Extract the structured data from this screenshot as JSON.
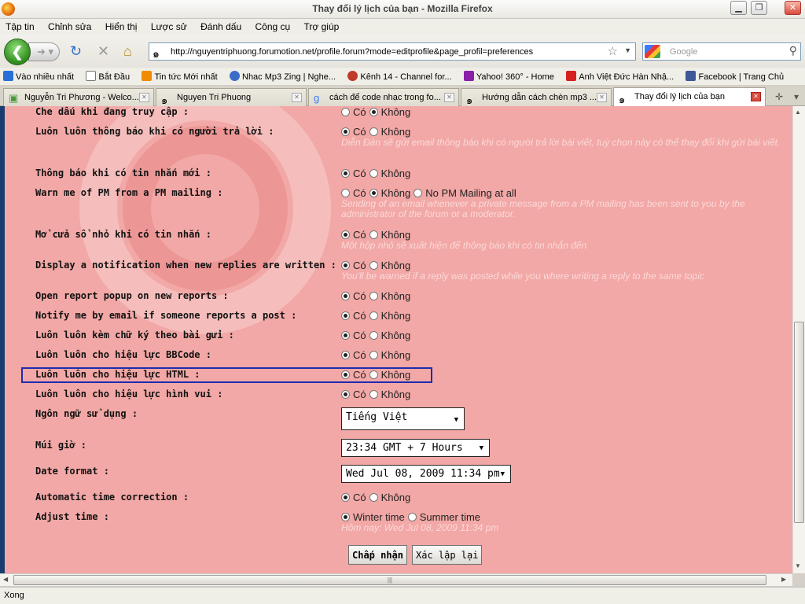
{
  "window": {
    "title": "Thay đổi lý lịch của bạn - Mozilla Firefox"
  },
  "menu": [
    "Tập tin",
    "Chỉnh sửa",
    "Hiển thị",
    "Lược sử",
    "Đánh dấu",
    "Công cụ",
    "Trợ giúp"
  ],
  "urlbar": {
    "url": "http://nguyentriphuong.forumotion.net/profile.forum?mode=editprofile&page_profil=preferences"
  },
  "search": {
    "placeholder": "Google"
  },
  "bookmarks": [
    {
      "label": "Vào nhiều nhất",
      "color": "#2a6fd6"
    },
    {
      "label": "Bắt Đầu",
      "color": "#ffffff"
    },
    {
      "label": "Tin tức Mới nhất",
      "color": "#f08a00"
    },
    {
      "label": "Nhac Mp3 Zing | Nghe...",
      "color": "#3b6cc7"
    },
    {
      "label": "Kênh 14 - Channel for...",
      "color": "#c0392b"
    },
    {
      "label": "Yahoo! 360° - Home",
      "color": "#8b1fa8"
    },
    {
      "label": "Anh Việt Đức Hàn Nhậ...",
      "color": "#d62020"
    },
    {
      "label": "Facebook | Trang Chủ",
      "color": "#3b5998"
    }
  ],
  "tabs": [
    {
      "label": "Nguyễn Tri Phương - Welco...",
      "icon": "chat-icon"
    },
    {
      "label": "Nguyen Tri Phuong",
      "icon": "forumotion-icon"
    },
    {
      "label": "cách để code nhạc trong fo...",
      "icon": "google-icon"
    },
    {
      "label": "Hướng dẫn cách chèn mp3 ...",
      "icon": "forumotion-icon"
    },
    {
      "label": "Thay đổi lý lịch của bạn",
      "icon": "forumotion-icon"
    }
  ],
  "form": {
    "rows": [
      {
        "label": "Che dấu khi đang truy cập :",
        "options": [
          "Có",
          "Không"
        ],
        "selected": 1
      },
      {
        "label": "Luôn luôn thông báo khi có người trả lời :",
        "options": [
          "Có",
          "Không"
        ],
        "selected": 0,
        "desc": "Diễn Đàn sẽ gửi email thông báo khi có người trả lời bài viết, tuỳ chọn này có thể thay đổi khi gửi bài viết."
      },
      {
        "label": "Thông báo khi có tin nhắn mới :",
        "options": [
          "Có",
          "Không"
        ],
        "selected": 0
      },
      {
        "label": "Warn me of PM from a PM mailing :",
        "options": [
          "Có",
          "Không",
          "No PM Mailing at all"
        ],
        "selected": 1,
        "desc": "Sending of an email whenever a private message from a PM mailing has been sent to you by the administrator of the forum or a moderator."
      },
      {
        "label": "Mở cửa sổ nhỏ khi có tin nhắn :",
        "options": [
          "Có",
          "Không"
        ],
        "selected": 0,
        "desc": "Một hộp nhỏ sẽ xuất hiện để thông báo khi có tin nhắn đến"
      },
      {
        "label": "Display a notification when new replies are written :",
        "options": [
          "Có",
          "Không"
        ],
        "selected": 0,
        "desc": "You'll be warned if a reply was posted while you where writing a reply to the same topic"
      },
      {
        "label": "Open report popup on new reports :",
        "options": [
          "Có",
          "Không"
        ],
        "selected": 0
      },
      {
        "label": "Notify me by email if someone reports a post :",
        "options": [
          "Có",
          "Không"
        ],
        "selected": 0
      },
      {
        "label": "Luôn luôn kèm chữ ký theo bài gửi :",
        "options": [
          "Có",
          "Không"
        ],
        "selected": 0
      },
      {
        "label": "Luôn luôn cho hiệu lực BBCode :",
        "options": [
          "Có",
          "Không"
        ],
        "selected": 0
      },
      {
        "label": "Luôn luôn cho hiệu lực HTML :",
        "options": [
          "Có",
          "Không"
        ],
        "selected": 0
      },
      {
        "label": "Luôn luôn cho hiệu lực hình vui :",
        "options": [
          "Có",
          "Không"
        ],
        "selected": 0
      }
    ],
    "language": {
      "label": "Ngôn ngữ sử dụng :",
      "value": "Tiếng Việt"
    },
    "timezone": {
      "label": "Múi giờ :",
      "value": "23:34 GMT + 7 Hours"
    },
    "dateformat": {
      "label": "Date format :",
      "value": "Wed Jul 08, 2009 11:34 pm"
    },
    "autotime": {
      "label": "Automatic time correction :",
      "options": [
        "Có",
        "Không"
      ],
      "selected": 0
    },
    "adjust": {
      "label": "Adjust time :",
      "options": [
        "Winter time",
        "Summer time"
      ],
      "selected": 0,
      "desc": "Hôm nay: Wed Jul 08, 2009 11:34 pm"
    }
  },
  "buttons": {
    "submit": "Chấp nhận",
    "reset": "Xác lập lại"
  },
  "status": "Xong"
}
